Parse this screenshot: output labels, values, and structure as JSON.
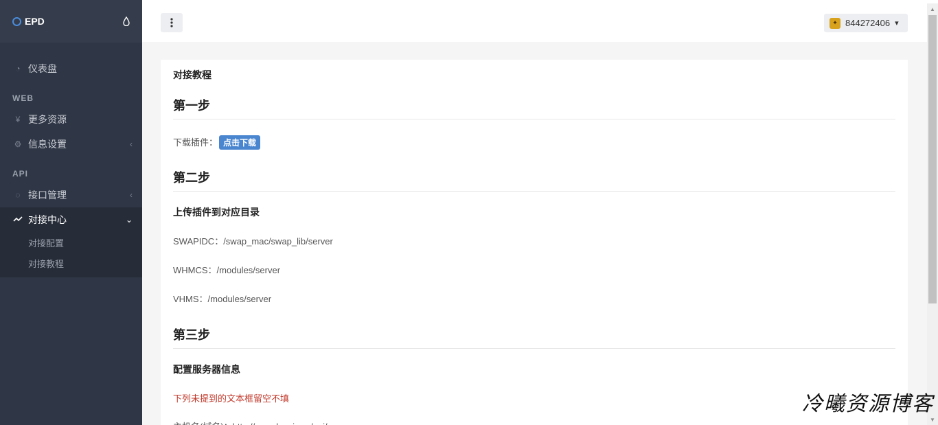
{
  "brand": {
    "name": "EPD"
  },
  "sidebar": {
    "dashboard": "仪表盘",
    "section_web": "WEB",
    "more_resources": "更多资源",
    "info_settings": "信息设置",
    "section_api": "API",
    "api_manage": "接口管理",
    "connect_center": "对接中心",
    "sub_items": [
      "对接配置",
      "对接教程"
    ]
  },
  "topbar": {
    "user_id": "844272406"
  },
  "content": {
    "title": "对接教程",
    "step1": {
      "heading": "第一步",
      "label": "下载插件：",
      "button": "点击下载"
    },
    "step2": {
      "heading": "第二步",
      "subtitle": "上传插件到对应目录",
      "lines": [
        "SWAPIDC：/swap_mac/swap_lib/server",
        "WHMCS：/modules/server",
        "VHMS：/modules/server"
      ]
    },
    "step3": {
      "heading": "第三步",
      "subtitle": "配置服务器信息",
      "warning": "下列未提到的文本框留空不填",
      "hostname": "主机名(域名)：http://www.lenxi.xyz/api/"
    }
  },
  "watermark": "冷曦资源博客",
  "colors": {
    "sidebar": "#2f3645",
    "accent": "#4a86d0",
    "warning": "#c0392b"
  }
}
